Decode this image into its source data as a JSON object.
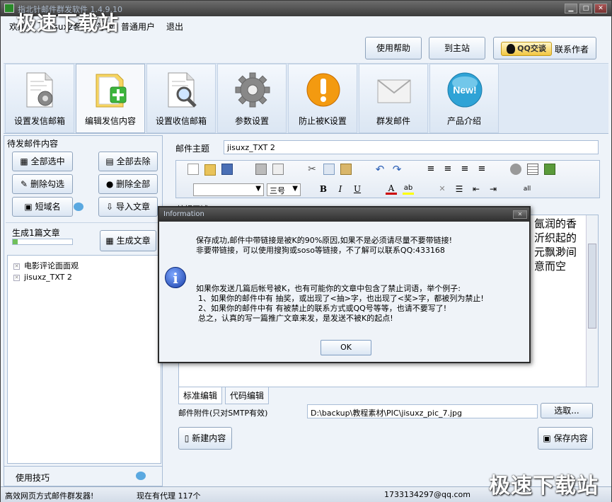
{
  "window": {
    "title": "指北针邮件群发软件 1.4.9.10"
  },
  "menubar": {
    "welcome": "欢迎",
    "user": "jisuxz客户",
    "level_label": "等级",
    "level": "普通用户",
    "logout": "退出"
  },
  "top_buttons": {
    "help": "使用帮助",
    "home": "到主站",
    "qq": "QQ交谈",
    "contact": "联系作者"
  },
  "tabs": [
    {
      "label": "设置发信邮箱",
      "icon": "document-gear-icon"
    },
    {
      "label": "编辑发信内容",
      "icon": "document-add-icon"
    },
    {
      "label": "设置收信邮箱",
      "icon": "document-search-icon"
    },
    {
      "label": "参数设置",
      "icon": "gear-icon"
    },
    {
      "label": "防止被K设置",
      "icon": "warning-icon"
    },
    {
      "label": "群发邮件",
      "icon": "envelope-icon"
    },
    {
      "label": "产品介绍",
      "icon": "new-badge-icon"
    }
  ],
  "left": {
    "section_title": "待发邮件内容",
    "select_all": "全部选中",
    "remove_all": "全部去除",
    "delete_checked": "删除勾选",
    "delete_all": "删除全部",
    "short_domain": "短域名",
    "import": "导入文章",
    "generated": "生成1篇文章",
    "generate": "生成文章",
    "items": [
      "电影评论面面观",
      "jisuxz_TXT 2"
    ],
    "tips": "使用技巧"
  },
  "right": {
    "subject_label": "邮件主题",
    "subject_value": "jisuxz_TXT 2",
    "font_size": "三号",
    "editor_label": "编辑区域",
    "editor_text": [
      "氤润的香",
      "沂织起的",
      "元飘渺间",
      "意而空"
    ],
    "tab_standard": "标准编辑",
    "tab_code": "代码编辑",
    "attachment_label": "邮件附件(只对SMTP有效)",
    "attachment_value": "D:\\backup\\教程素材\\PIC\\jisuxz_pic_7.jpg",
    "choose": "选取...",
    "new_content": "新建内容",
    "save_content": "保存内容"
  },
  "status": {
    "slogan": "高效网页方式邮件群发器!",
    "proxy": "现在有代理 117个",
    "email": "1733134297@qq.com"
  },
  "watermark": {
    "top": "极速下载站",
    "bottom": "极速下载站"
  },
  "dialog": {
    "title": "Information",
    "line1": "保存成功,邮件中带链接是被K的90%原因,如果不是必须请尽量不要带链接!",
    "line2": "非要带链接，可以使用搜狗或soso等链接，不了解可以联系QQ:433168",
    "line3": "如果你发送几篇后帐号被K，也有可能你的文章中包含了禁止词语，举个例子:",
    "line4": "1、如果你的邮件中有 抽奖，或出现了<抽>字，也出现了<奖>字，都被列为禁止!",
    "line5": "2、如果你的邮件中有 有被禁止的联系方式或QQ号等等，也请不要写了!",
    "line6": "总之，认真的写一篇推广文章来发，是发送不被K的起点!",
    "ok": "OK"
  }
}
